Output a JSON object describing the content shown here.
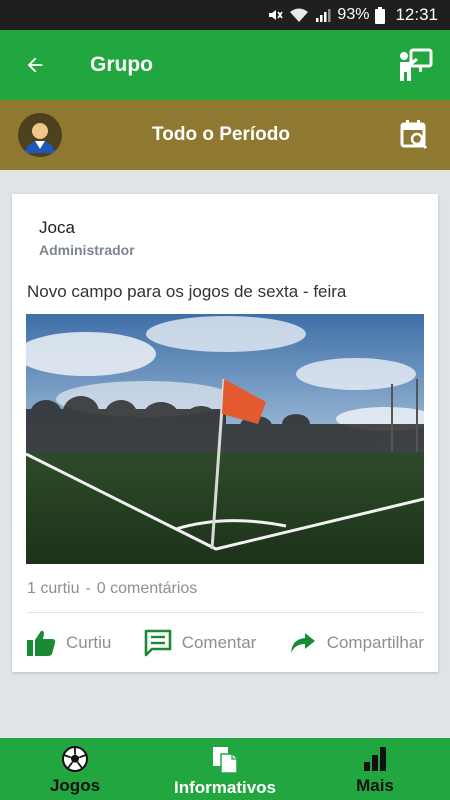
{
  "status_bar": {
    "battery": "93%",
    "time": "12:31"
  },
  "app_bar": {
    "title": "Grupo"
  },
  "filter_bar": {
    "period_label": "Todo o Período"
  },
  "post": {
    "author": "Joca",
    "role": "Administrador",
    "text": "Novo campo para os jogos de sexta - feira",
    "likes": "1 curtiu",
    "separator": "-",
    "comments": "0 comentários",
    "actions": {
      "like": "Curtiu",
      "comment": "Comentar",
      "share": "Compartilhar"
    }
  },
  "bottom_nav": {
    "items": [
      {
        "label": "Jogos",
        "icon": "soccer-ball-icon"
      },
      {
        "label": "Informativos",
        "icon": "documents-icon"
      },
      {
        "label": "Mais",
        "icon": "bar-chart-icon"
      }
    ],
    "active": "Informativos"
  },
  "colors": {
    "primary": "#22a63f",
    "filter_bar": "#8f7830",
    "action_green": "#1b8a34",
    "muted_text": "#8a8f95"
  }
}
